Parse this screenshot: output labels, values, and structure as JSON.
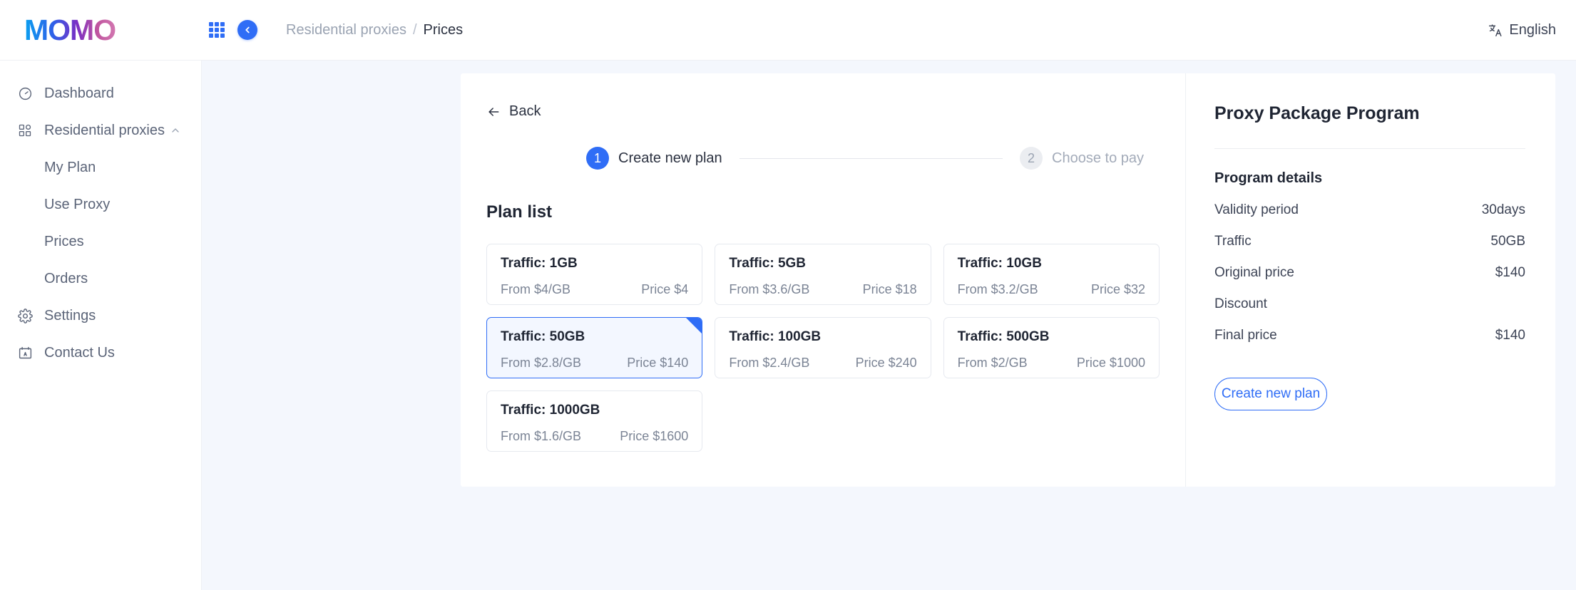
{
  "header": {
    "logo_text": "MOMO",
    "apps_icon": "grid-apps-icon",
    "collapse_icon": "chevron-left-icon",
    "breadcrumb": {
      "parent": "Residential proxies",
      "separator": "/",
      "current": "Prices"
    },
    "language": {
      "icon": "translate-icon",
      "label": "English"
    }
  },
  "sidebar": {
    "items": [
      {
        "label": "Dashboard",
        "icon": "dashboard-gauge-icon",
        "type": "top"
      },
      {
        "label": "Residential proxies",
        "icon": "grid-blocks-icon",
        "type": "top",
        "expanded": true,
        "chevron": "chevron-up-icon"
      },
      {
        "label": "My Plan",
        "type": "sub"
      },
      {
        "label": "Use Proxy",
        "type": "sub"
      },
      {
        "label": "Prices",
        "type": "sub"
      },
      {
        "label": "Orders",
        "type": "sub"
      },
      {
        "label": "Settings",
        "icon": "gear-icon",
        "type": "top"
      },
      {
        "label": "Contact Us",
        "icon": "contact-card-icon",
        "type": "top"
      }
    ]
  },
  "main": {
    "back_label": "Back",
    "back_icon": "arrow-left-icon",
    "steps": [
      {
        "number": "1",
        "label": "Create new plan",
        "state": "active"
      },
      {
        "number": "2",
        "label": "Choose to pay",
        "state": "idle"
      }
    ],
    "plan_list_title": "Plan list",
    "plans": [
      {
        "traffic": "Traffic: 1GB",
        "unit": "From $4/GB",
        "price": "Price $4",
        "selected": false
      },
      {
        "traffic": "Traffic: 5GB",
        "unit": "From $3.6/GB",
        "price": "Price $18",
        "selected": false
      },
      {
        "traffic": "Traffic: 10GB",
        "unit": "From $3.2/GB",
        "price": "Price $32",
        "selected": false
      },
      {
        "traffic": "Traffic: 50GB",
        "unit": "From $2.8/GB",
        "price": "Price $140",
        "selected": true
      },
      {
        "traffic": "Traffic: 100GB",
        "unit": "From $2.4/GB",
        "price": "Price $240",
        "selected": false
      },
      {
        "traffic": "Traffic: 500GB",
        "unit": "From $2/GB",
        "price": "Price $1000",
        "selected": false
      },
      {
        "traffic": "Traffic: 1000GB",
        "unit": "From $1.6/GB",
        "price": "Price $1600",
        "selected": false
      }
    ]
  },
  "summary": {
    "title": "Proxy Package Program",
    "details_heading": "Program details",
    "rows": [
      {
        "key": "Validity period",
        "value": "30days"
      },
      {
        "key": "Traffic",
        "value": "50GB"
      },
      {
        "key": "Original price",
        "value": "$140"
      },
      {
        "key": "Discount",
        "value": ""
      },
      {
        "key": "Final price",
        "value": "$140"
      }
    ],
    "cta_label": "Create new plan"
  },
  "colors": {
    "accent": "#2f6df6",
    "page_bg": "#f4f7fd",
    "selected_card_bg": "#f3f7ff",
    "muted_text": "#9aa3b2"
  }
}
